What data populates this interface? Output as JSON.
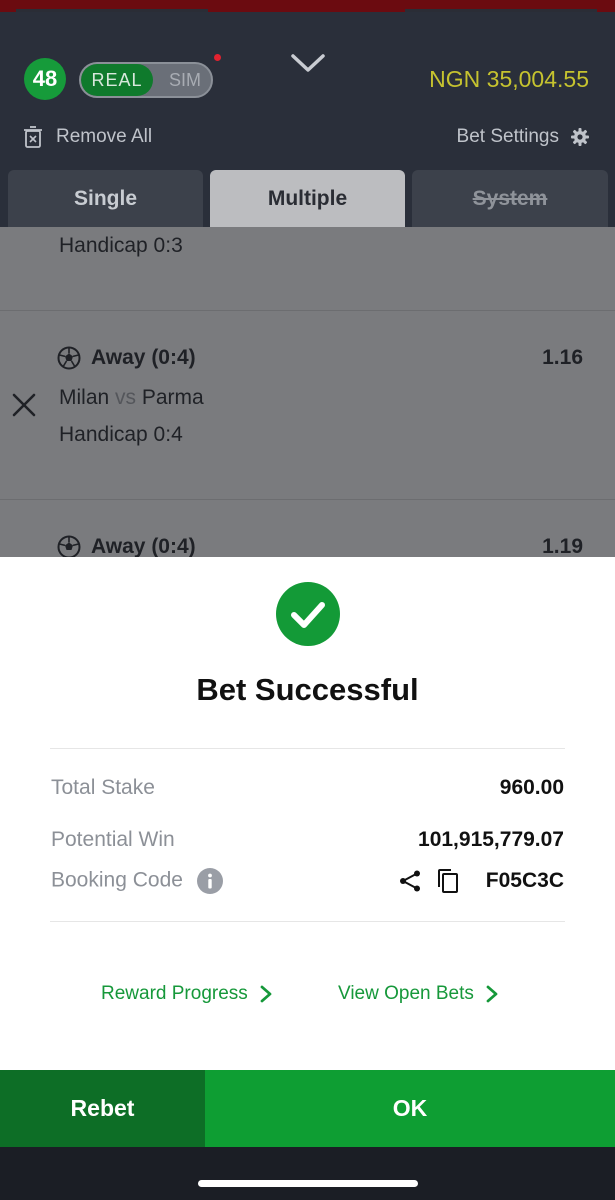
{
  "header": {
    "level": "48",
    "mode_real": "REAL",
    "mode_sim": "SIM",
    "balance": "NGN 35,004.55",
    "remove_all": "Remove All",
    "bet_settings": "Bet Settings"
  },
  "tabs": [
    {
      "label": "Single"
    },
    {
      "label": "Multiple"
    },
    {
      "label": "System"
    }
  ],
  "bets": [
    {
      "handicap": "Handicap 0:3"
    },
    {
      "market": "Away (0:4)",
      "odds": "1.16",
      "home": "Milan",
      "vs": "vs",
      "away": "Parma",
      "handicap": "Handicap 0:4"
    },
    {
      "market": "Away (0:4)",
      "odds": "1.19"
    }
  ],
  "success": {
    "title": "Bet Successful",
    "total_stake_label": "Total Stake",
    "total_stake_value": "960.00",
    "potential_win_label": "Potential Win",
    "potential_win_value": "101,915,779.07",
    "booking_code_label": "Booking Code",
    "booking_code_value": "F05C3C",
    "reward_progress": "Reward Progress",
    "view_open_bets": "View Open Bets"
  },
  "footer": {
    "rebet": "Rebet",
    "ok": "OK"
  },
  "colors": {
    "accent_green": "#0e9e33",
    "balance_yellow": "#c6c32f",
    "header_bg": "#2a2f3a"
  }
}
